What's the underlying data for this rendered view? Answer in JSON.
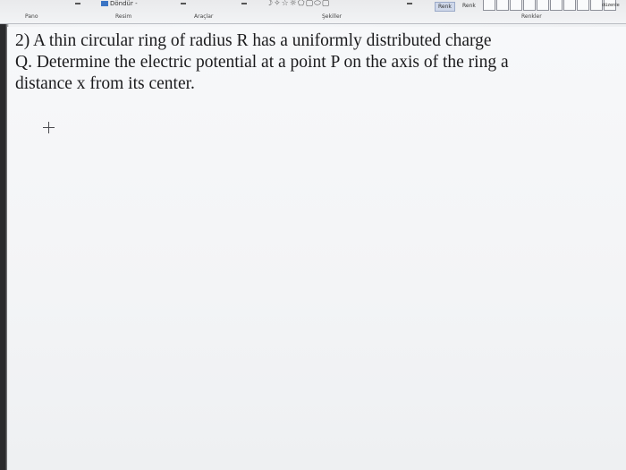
{
  "ribbon": {
    "rotate_label": "Döndür",
    "rotate_suffix": "-",
    "shapes_glyphs": "☽✧☆☼⬠▢⬭▢",
    "color1_label": "Renk",
    "color2_label": "Renk",
    "edit_colors_label": "düzenle",
    "groups": {
      "clipboard": "Pano",
      "image": "Resim",
      "tools": "Araçlar",
      "shapes": "Şekiller",
      "colors": "Renkler"
    }
  },
  "canvas": {
    "question_text": "2) A thin circular ring of radius R has a uniformly distributed charge\nQ. Determine the electric potential at a point P on the axis of the ring a\ndistance x from its center."
  }
}
